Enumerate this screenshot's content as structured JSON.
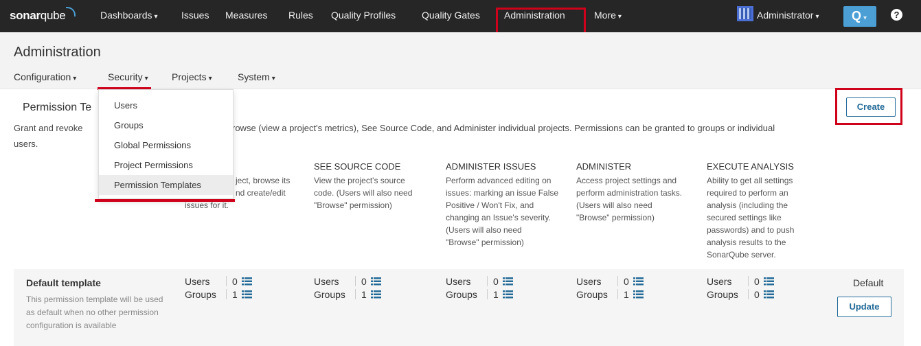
{
  "topnav": {
    "logo_bold": "sonar",
    "logo_rest": "qube",
    "items": [
      {
        "label": "Dashboards",
        "caret": "▾"
      },
      {
        "label": "Issues"
      },
      {
        "label": "Measures"
      },
      {
        "label": "Rules"
      },
      {
        "label": "Quality Profiles"
      },
      {
        "label": "Quality Gates"
      },
      {
        "label": "Administration"
      },
      {
        "label": "More",
        "caret": "▾"
      }
    ],
    "user_label": "Administrator",
    "caret": "▾",
    "search_icon": "Q",
    "help_icon": "?"
  },
  "admin": {
    "title": "Administration",
    "subnav": [
      {
        "label": "Configuration",
        "caret": "▾"
      },
      {
        "label": "Security",
        "caret": "▾"
      },
      {
        "label": "Projects",
        "caret": "▾"
      },
      {
        "label": "System",
        "caret": "▾"
      }
    ]
  },
  "security_menu": {
    "items": [
      "Users",
      "Groups",
      "Global Permissions",
      "Project Permissions",
      "Permission Templates"
    ],
    "active": "Permission Templates"
  },
  "page": {
    "title": "Permission Te",
    "desc_left": "Grant and revoke",
    "desc_right": "rowse (view a project's metrics), See Source Code, and Administer individual projects. Permissions can be granted to groups or individual",
    "desc_line2": "users.",
    "create_label": "Create"
  },
  "columns": [
    {
      "head": "",
      "desc": [
        "ject, browse its",
        "nd create/edit",
        "issues for it."
      ]
    },
    {
      "head": "SEE SOURCE CODE",
      "desc": [
        "View the project's source",
        "code. (Users will also need",
        "\"Browse\" permission)"
      ]
    },
    {
      "head": "ADMINISTER ISSUES",
      "desc": [
        "Perform advanced editing on",
        "issues: marking an issue False",
        "Positive / Won't Fix, and",
        "changing an Issue's severity.",
        "(Users will also need",
        "\"Browse\" permission)"
      ]
    },
    {
      "head": "ADMINISTER",
      "desc": [
        "Access project settings and",
        "perform administration tasks.",
        "(Users will also need",
        "\"Browse\" permission)"
      ]
    },
    {
      "head": "EXECUTE ANALYSIS",
      "desc": [
        "Ability to get all settings",
        "required to perform an",
        "analysis (including the",
        "secured settings like",
        "passwords) and to push",
        "analysis results to the",
        "SonarQube server."
      ]
    }
  ],
  "template": {
    "name": "Default template",
    "desc": "This permission template will be used as default when no other permission configuration is available",
    "users_label": "Users",
    "groups_label": "Groups",
    "perms": [
      {
        "users": "0",
        "groups": "1"
      },
      {
        "users": "0",
        "groups": "1"
      },
      {
        "users": "0",
        "groups": "1"
      },
      {
        "users": "0",
        "groups": "1"
      },
      {
        "users": "0",
        "groups": "0"
      }
    ],
    "default_label": "Default",
    "update_label": "Update"
  }
}
